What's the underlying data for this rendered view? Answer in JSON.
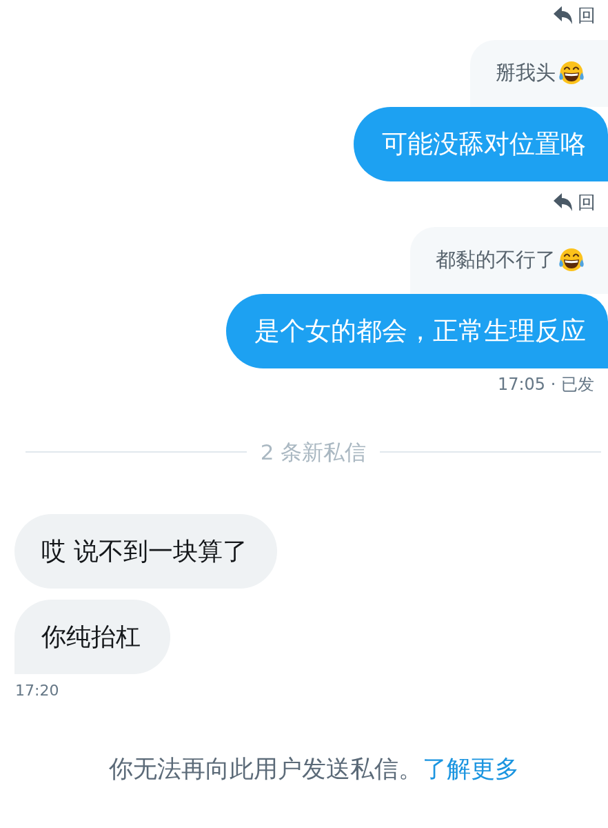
{
  "sent_messages": [
    {
      "reply_label": "回",
      "quote": {
        "text": "掰我头",
        "trailing_emoji": true
      },
      "text": "可能没舔对位置咯"
    },
    {
      "reply_label": "回",
      "quote": {
        "text": "都黏的不行了",
        "trailing_emoji": true
      },
      "text": "是个女的都会，正常生理反应"
    }
  ],
  "sent_meta": "17:05 · 已发",
  "divider": "2 条新私信",
  "received_messages": [
    {
      "text": "哎 说不到一块算了"
    },
    {
      "text": "你纯抬杠"
    }
  ],
  "received_meta": "17:20",
  "notice": {
    "text": "你无法再向此用户发送私信。",
    "link": "了解更多"
  }
}
